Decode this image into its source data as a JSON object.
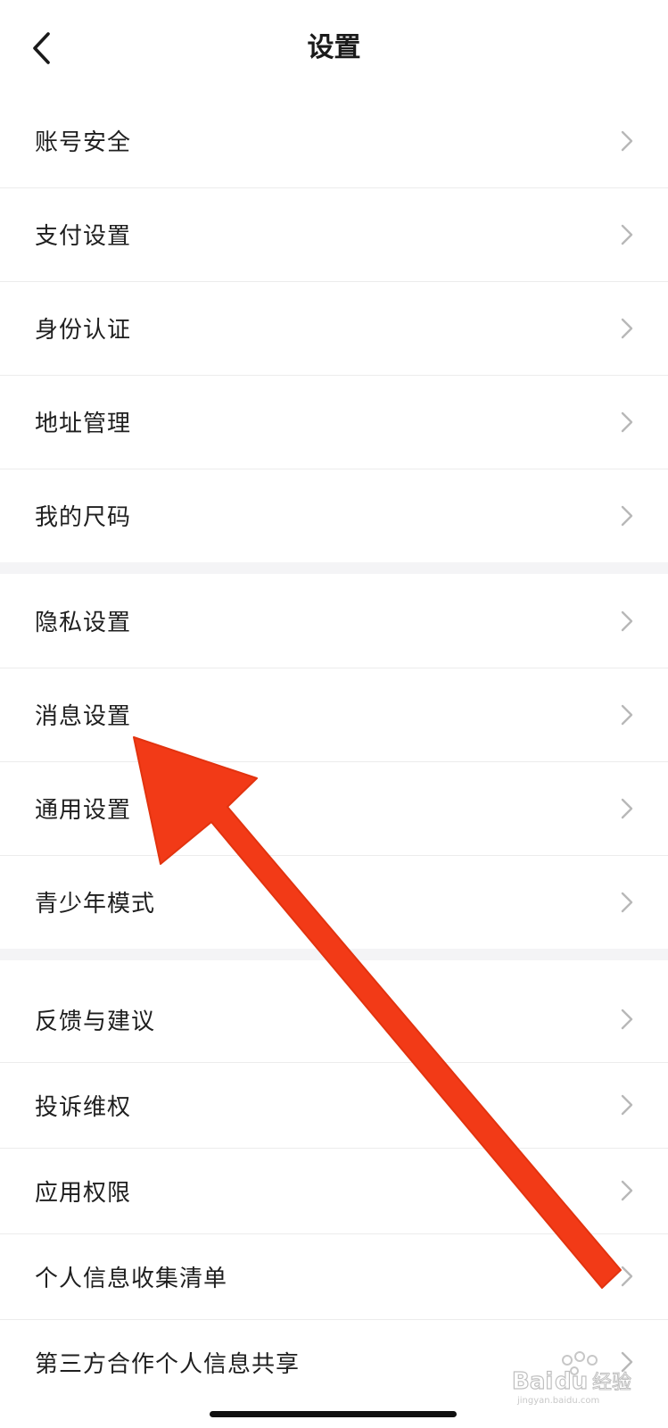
{
  "header": {
    "title": "设置",
    "back_icon": "chevron-left-icon"
  },
  "groups": [
    {
      "items": [
        {
          "label": "账号安全"
        },
        {
          "label": "支付设置"
        },
        {
          "label": "身份认证"
        },
        {
          "label": "地址管理"
        },
        {
          "label": "我的尺码"
        }
      ]
    },
    {
      "items": [
        {
          "label": "隐私设置"
        },
        {
          "label": "消息设置"
        },
        {
          "label": "通用设置"
        },
        {
          "label": "青少年模式"
        }
      ]
    },
    {
      "items": [
        {
          "label": "反馈与建议"
        },
        {
          "label": "投诉维权"
        },
        {
          "label": "应用权限"
        },
        {
          "label": "个人信息收集清单"
        },
        {
          "label": "第三方合作个人信息共享"
        }
      ]
    }
  ],
  "overlay": {
    "arrow_color": "#f23a17",
    "arrow_target": "消息设置"
  },
  "colors": {
    "background": "#ffffff",
    "section_gap": "#f4f4f6",
    "divider": "#ececec",
    "chevron": "#b8b8b8",
    "text": "#1f1f1f"
  },
  "watermark": {
    "text": "Baidu经验",
    "subtext": "jingyan.baidu.com"
  }
}
